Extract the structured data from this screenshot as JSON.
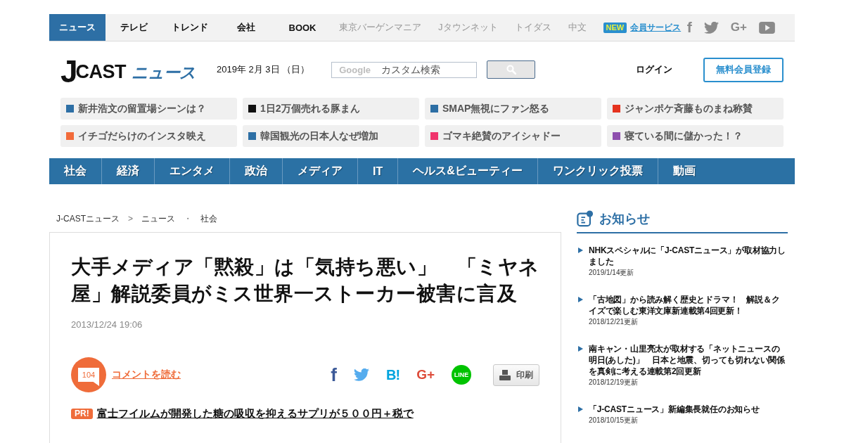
{
  "top_nav": {
    "items": [
      {
        "label": "ニュース",
        "kind": "section",
        "selected": true
      },
      {
        "label": "テレビ",
        "kind": "section",
        "selected": false
      },
      {
        "label": "トレンド",
        "kind": "section",
        "selected": false
      },
      {
        "label": "会社",
        "kind": "section",
        "selected": false
      },
      {
        "label": "BOOK",
        "kind": "section",
        "selected": false
      },
      {
        "label": "東京バーゲンマニア",
        "kind": "partner",
        "selected": false
      },
      {
        "label": "Jタウンネット",
        "kind": "partner",
        "selected": false
      },
      {
        "label": "トイダス",
        "kind": "partner",
        "selected": false
      },
      {
        "label": "中文",
        "kind": "partner",
        "selected": false
      }
    ],
    "member_service": {
      "badge": "NEW",
      "label": "会員サービス"
    },
    "social": [
      {
        "kind": "facebook",
        "label": "f"
      },
      {
        "kind": "twitter"
      },
      {
        "kind": "googleplus",
        "label": "G+"
      },
      {
        "kind": "youtube"
      }
    ]
  },
  "header": {
    "logo": {
      "initial": "J",
      "name": "CAST",
      "service": "ニュース"
    },
    "date": "2019年 2月 3日 （日）",
    "search": {
      "watermark": "Google",
      "placeholder": "カスタム検索"
    },
    "login": "ログイン",
    "signup": "無料会員登録"
  },
  "trending_tags": [
    {
      "label": "新井浩文の留置場シーンは？",
      "color": "#2d6fa5"
    },
    {
      "label": "1日2万個売れる豚まん",
      "color": "#111111"
    },
    {
      "label": "SMAP無視にファン怒る",
      "color": "#2d6fa5"
    },
    {
      "label": "ジャンポケ斉藤ものまね称賛",
      "color": "#e5331f"
    },
    {
      "label": "イチゴだらけのインスタ映え",
      "color": "#f26b3a"
    },
    {
      "label": "韓国観光の日本人なぜ増加",
      "color": "#2d6fa5"
    },
    {
      "label": "ゴマキ絶賛のアイシャドー",
      "color": "#f0336c"
    },
    {
      "label": "寝ている間に儲かった！？",
      "color": "#8e4fae"
    }
  ],
  "categories": [
    {
      "label": "社会"
    },
    {
      "label": "経済"
    },
    {
      "label": "エンタメ"
    },
    {
      "label": "政治"
    },
    {
      "label": "メディア"
    },
    {
      "label": "IT"
    },
    {
      "label": "ヘルス&ビューティー"
    },
    {
      "label": "ワンクリック投票"
    },
    {
      "label": "動画"
    }
  ],
  "breadcrumb": [
    {
      "kind": "link",
      "label": "J-CASTニュース"
    },
    {
      "kind": "separator",
      "label": ">"
    },
    {
      "kind": "link",
      "label": "ニュース"
    },
    {
      "kind": "separator",
      "label": "・"
    },
    {
      "kind": "link",
      "label": "社会"
    }
  ],
  "article": {
    "title": "大手メディア「黙殺」は「気持ち悪い」　「ミヤネ屋」解説委員がミス世界一ストーカー被害に言及",
    "date": "2013/12/24 19:06",
    "comments": {
      "count": "104",
      "label": "コメントを読む"
    },
    "share": [
      {
        "kind": "facebook",
        "label": "f"
      },
      {
        "kind": "twitter"
      },
      {
        "kind": "hatena",
        "label": "B!"
      },
      {
        "kind": "googleplus",
        "label": "G+"
      },
      {
        "kind": "line",
        "label": "LINE"
      }
    ],
    "print": "印刷",
    "promo": {
      "badge": "PR!",
      "text": "富士フイルムが開発した糖の吸収を抑えるサプリが５００円＋税で"
    }
  },
  "sidebar": {
    "title": "お知らせ",
    "items": [
      {
        "title": "NHKスペシャルに「J-CASTニュース」が取材協力しました",
        "date": "2019/1/14更新"
      },
      {
        "title": "「古地図」から読み解く歴史とドラマ！　解説＆クイズで楽しむ東洋文庫新連載第4回更新！",
        "date": "2018/12/21更新"
      },
      {
        "title": "南キャン・山里亮太が取材する「ネットニュースの明日(あした)」　日本と地震、切っても切れない関係を真剣に考える連載第2回更新",
        "date": "2018/12/19更新"
      },
      {
        "title": "「J-CASTニュース」新編集長就任のお知らせ",
        "date": "2018/10/15更新"
      }
    ]
  }
}
